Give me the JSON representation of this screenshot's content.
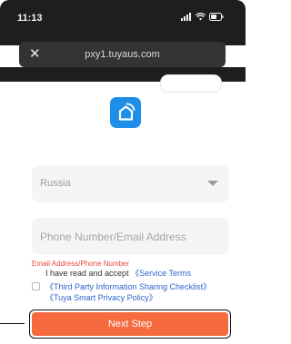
{
  "status_bar": {
    "time": "11:13",
    "icons": [
      "signal-icon",
      "wifi-icon",
      "battery-icon"
    ]
  },
  "browser": {
    "url": "pxy1.tuyaus.com",
    "close_glyph": "✕"
  },
  "app_logo": {
    "icon": "smart-home-icon",
    "color": "#1f8ee8"
  },
  "form": {
    "country_value": "Russia",
    "account_placeholder": "Phone Number/Email Address",
    "error_text": "Email Address/Phone Number",
    "agreement_text": "I have read and accept",
    "service_terms_link": "《Service Terms",
    "sharing_checklist_link": "《Third Party Information Sharing Checklist》",
    "privacy_policy_link": "《Tuya Smart Privacy Policy》"
  },
  "buttons": {
    "next_step": "Next Step"
  },
  "colors": {
    "accent": "#f56a3e",
    "link": "#2f64c9",
    "error": "#e8483f",
    "status_bar_bg": "#1e1e20"
  }
}
